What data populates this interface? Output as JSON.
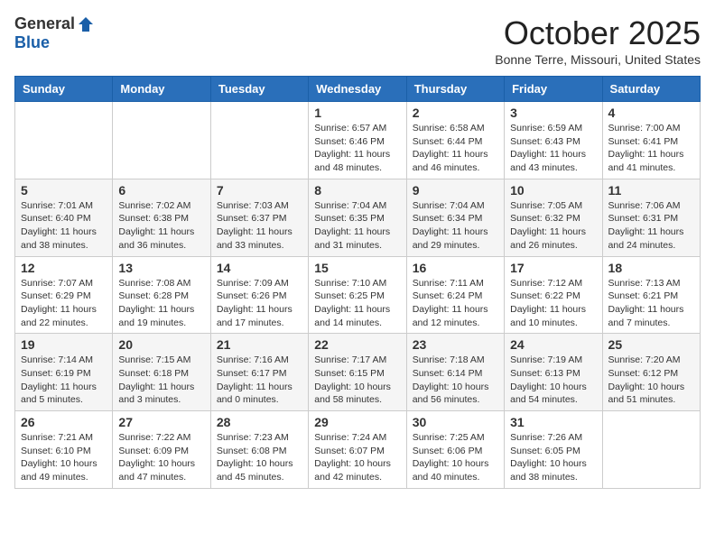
{
  "header": {
    "logo_general": "General",
    "logo_blue": "Blue",
    "month": "October 2025",
    "location": "Bonne Terre, Missouri, United States"
  },
  "days_of_week": [
    "Sunday",
    "Monday",
    "Tuesday",
    "Wednesday",
    "Thursday",
    "Friday",
    "Saturday"
  ],
  "weeks": [
    [
      {
        "day": "",
        "info": ""
      },
      {
        "day": "",
        "info": ""
      },
      {
        "day": "",
        "info": ""
      },
      {
        "day": "1",
        "info": "Sunrise: 6:57 AM\nSunset: 6:46 PM\nDaylight: 11 hours\nand 48 minutes."
      },
      {
        "day": "2",
        "info": "Sunrise: 6:58 AM\nSunset: 6:44 PM\nDaylight: 11 hours\nand 46 minutes."
      },
      {
        "day": "3",
        "info": "Sunrise: 6:59 AM\nSunset: 6:43 PM\nDaylight: 11 hours\nand 43 minutes."
      },
      {
        "day": "4",
        "info": "Sunrise: 7:00 AM\nSunset: 6:41 PM\nDaylight: 11 hours\nand 41 minutes."
      }
    ],
    [
      {
        "day": "5",
        "info": "Sunrise: 7:01 AM\nSunset: 6:40 PM\nDaylight: 11 hours\nand 38 minutes."
      },
      {
        "day": "6",
        "info": "Sunrise: 7:02 AM\nSunset: 6:38 PM\nDaylight: 11 hours\nand 36 minutes."
      },
      {
        "day": "7",
        "info": "Sunrise: 7:03 AM\nSunset: 6:37 PM\nDaylight: 11 hours\nand 33 minutes."
      },
      {
        "day": "8",
        "info": "Sunrise: 7:04 AM\nSunset: 6:35 PM\nDaylight: 11 hours\nand 31 minutes."
      },
      {
        "day": "9",
        "info": "Sunrise: 7:04 AM\nSunset: 6:34 PM\nDaylight: 11 hours\nand 29 minutes."
      },
      {
        "day": "10",
        "info": "Sunrise: 7:05 AM\nSunset: 6:32 PM\nDaylight: 11 hours\nand 26 minutes."
      },
      {
        "day": "11",
        "info": "Sunrise: 7:06 AM\nSunset: 6:31 PM\nDaylight: 11 hours\nand 24 minutes."
      }
    ],
    [
      {
        "day": "12",
        "info": "Sunrise: 7:07 AM\nSunset: 6:29 PM\nDaylight: 11 hours\nand 22 minutes."
      },
      {
        "day": "13",
        "info": "Sunrise: 7:08 AM\nSunset: 6:28 PM\nDaylight: 11 hours\nand 19 minutes."
      },
      {
        "day": "14",
        "info": "Sunrise: 7:09 AM\nSunset: 6:26 PM\nDaylight: 11 hours\nand 17 minutes."
      },
      {
        "day": "15",
        "info": "Sunrise: 7:10 AM\nSunset: 6:25 PM\nDaylight: 11 hours\nand 14 minutes."
      },
      {
        "day": "16",
        "info": "Sunrise: 7:11 AM\nSunset: 6:24 PM\nDaylight: 11 hours\nand 12 minutes."
      },
      {
        "day": "17",
        "info": "Sunrise: 7:12 AM\nSunset: 6:22 PM\nDaylight: 11 hours\nand 10 minutes."
      },
      {
        "day": "18",
        "info": "Sunrise: 7:13 AM\nSunset: 6:21 PM\nDaylight: 11 hours\nand 7 minutes."
      }
    ],
    [
      {
        "day": "19",
        "info": "Sunrise: 7:14 AM\nSunset: 6:19 PM\nDaylight: 11 hours\nand 5 minutes."
      },
      {
        "day": "20",
        "info": "Sunrise: 7:15 AM\nSunset: 6:18 PM\nDaylight: 11 hours\nand 3 minutes."
      },
      {
        "day": "21",
        "info": "Sunrise: 7:16 AM\nSunset: 6:17 PM\nDaylight: 11 hours\nand 0 minutes."
      },
      {
        "day": "22",
        "info": "Sunrise: 7:17 AM\nSunset: 6:15 PM\nDaylight: 10 hours\nand 58 minutes."
      },
      {
        "day": "23",
        "info": "Sunrise: 7:18 AM\nSunset: 6:14 PM\nDaylight: 10 hours\nand 56 minutes."
      },
      {
        "day": "24",
        "info": "Sunrise: 7:19 AM\nSunset: 6:13 PM\nDaylight: 10 hours\nand 54 minutes."
      },
      {
        "day": "25",
        "info": "Sunrise: 7:20 AM\nSunset: 6:12 PM\nDaylight: 10 hours\nand 51 minutes."
      }
    ],
    [
      {
        "day": "26",
        "info": "Sunrise: 7:21 AM\nSunset: 6:10 PM\nDaylight: 10 hours\nand 49 minutes."
      },
      {
        "day": "27",
        "info": "Sunrise: 7:22 AM\nSunset: 6:09 PM\nDaylight: 10 hours\nand 47 minutes."
      },
      {
        "day": "28",
        "info": "Sunrise: 7:23 AM\nSunset: 6:08 PM\nDaylight: 10 hours\nand 45 minutes."
      },
      {
        "day": "29",
        "info": "Sunrise: 7:24 AM\nSunset: 6:07 PM\nDaylight: 10 hours\nand 42 minutes."
      },
      {
        "day": "30",
        "info": "Sunrise: 7:25 AM\nSunset: 6:06 PM\nDaylight: 10 hours\nand 40 minutes."
      },
      {
        "day": "31",
        "info": "Sunrise: 7:26 AM\nSunset: 6:05 PM\nDaylight: 10 hours\nand 38 minutes."
      },
      {
        "day": "",
        "info": ""
      }
    ]
  ]
}
